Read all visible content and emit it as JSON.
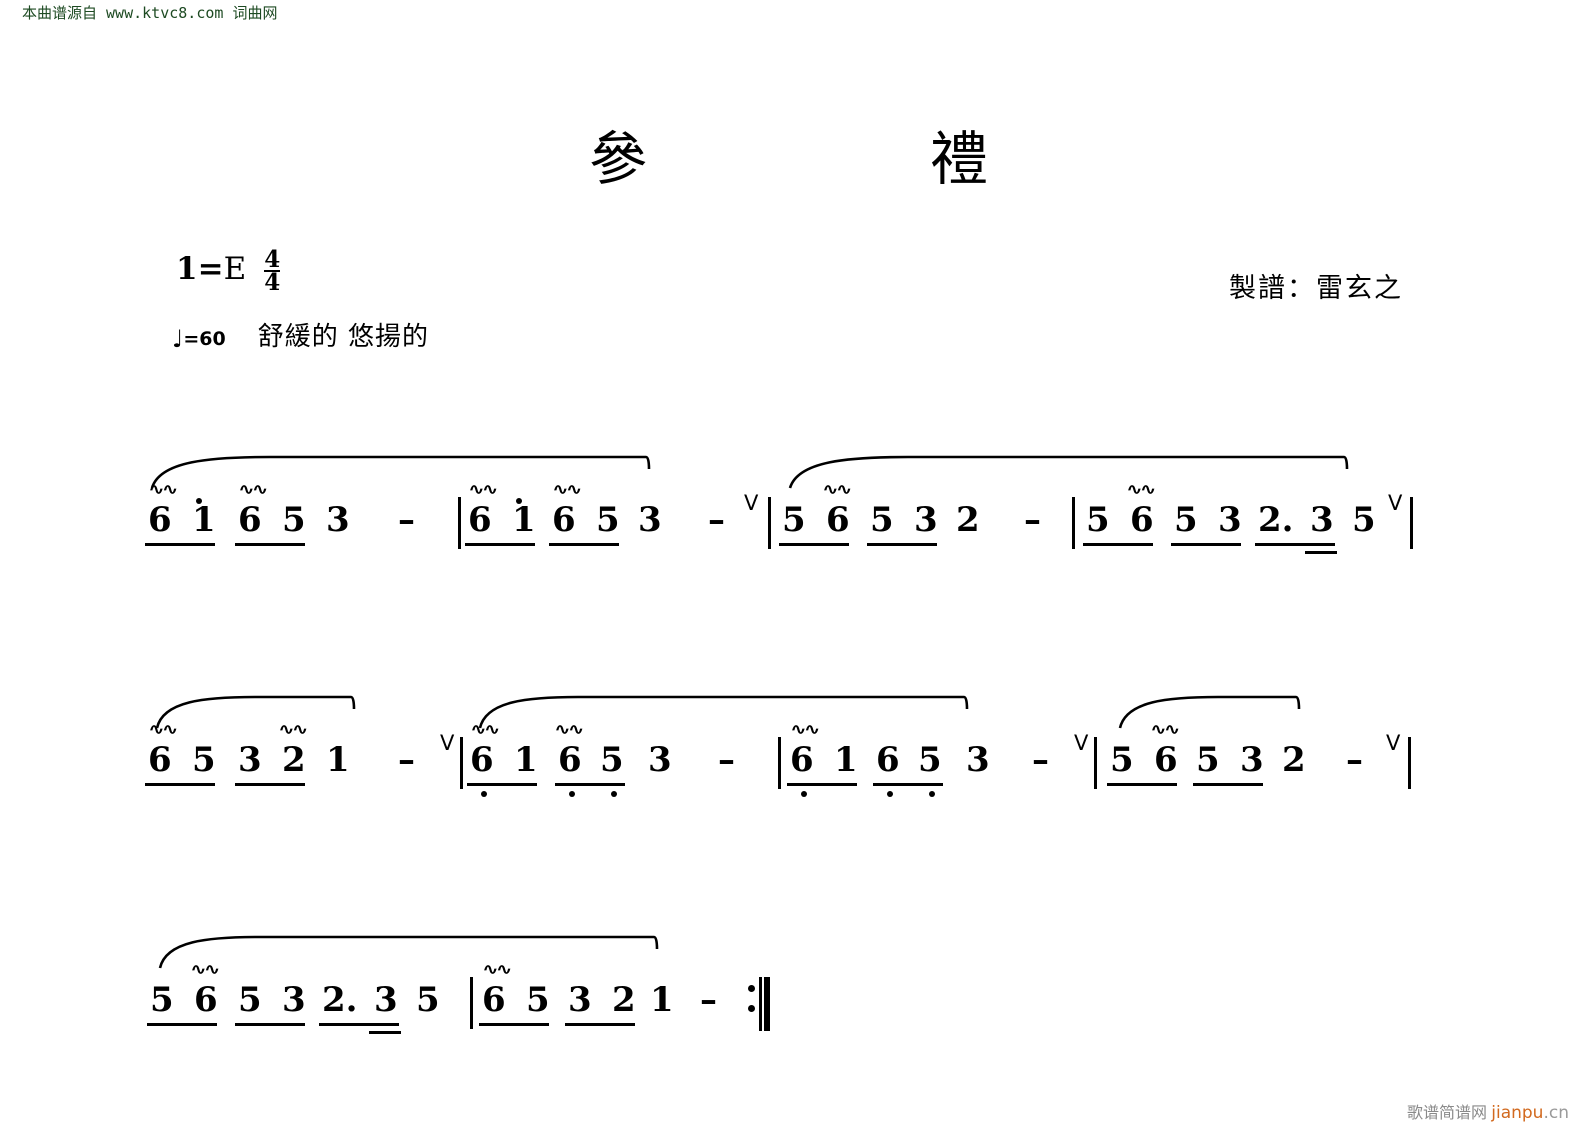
{
  "watermarks": {
    "top_left": "本曲谱源自 www.ktvc8.com 词曲网",
    "bottom_right_cn": "歌谱简谱网",
    "bottom_right_site": "jianpu",
    "bottom_right_tld": ".cn"
  },
  "header": {
    "title_left": "參",
    "title_right": "禮",
    "key_label": "1",
    "key_equals": "=",
    "key_value": "E",
    "time_numerator": "4",
    "time_denominator": "4",
    "tempo_note_glyph": "♩",
    "tempo_value": "=60",
    "expression": "舒緩的 悠揚的",
    "composer_credit": "製譜：雷玄之"
  },
  "colors": {
    "ink": "#000000",
    "watermark_top": "#1d4a22",
    "watermark_gray": "#8a8a8a",
    "watermark_orange": "#d2691e"
  },
  "score": {
    "notation_type": "jianpu-numbered-musical-notation",
    "symbols": {
      "trill": "~~",
      "breath_mark": "V",
      "sustain_dash": "–",
      "octave_up_dot": "dot-above",
      "octave_down_dot": "dot-below",
      "repeat_end": ":||"
    },
    "lines": [
      {
        "index": 1,
        "measures": [
          {
            "notes": [
              "6",
              "1",
              "6",
              "5",
              "3",
              "–"
            ],
            "beams": [
              [
                0,
                1
              ],
              [
                2,
                3
              ]
            ],
            "trills": [
              0,
              2
            ],
            "octave_up": [
              1
            ]
          },
          {
            "notes": [
              "6",
              "1",
              "6",
              "5",
              "3",
              "–"
            ],
            "beams": [
              [
                0,
                1
              ],
              [
                2,
                3
              ]
            ],
            "trills": [
              0,
              2
            ],
            "octave_up": [
              1
            ],
            "breath_after": true
          },
          {
            "notes": [
              "5",
              "6",
              "5",
              "3",
              "2",
              "–"
            ],
            "beams": [
              [
                0,
                1
              ],
              [
                2,
                3
              ]
            ],
            "trills": [
              1
            ]
          },
          {
            "notes": [
              "5",
              "6",
              "5",
              "3",
              "2.",
              "3",
              "5"
            ],
            "beams": [
              [
                0,
                1
              ],
              [
                2,
                3
              ],
              [
                4,
                5
              ]
            ],
            "trills": [
              1
            ],
            "dotted": [
              4
            ],
            "sixteenth": [
              5
            ],
            "breath_after": true
          }
        ]
      },
      {
        "index": 2,
        "measures": [
          {
            "notes": [
              "6",
              "5",
              "3",
              "2",
              "1",
              "–"
            ],
            "beams": [
              [
                0,
                1
              ],
              [
                2,
                3
              ]
            ],
            "trills": [
              0,
              3
            ],
            "breath_after": true
          },
          {
            "notes": [
              "6",
              "1",
              "6",
              "5",
              "3",
              "–"
            ],
            "beams": [
              [
                0,
                1
              ],
              [
                2,
                3
              ]
            ],
            "trills": [
              0,
              2
            ],
            "octave_down": [
              0,
              2,
              3
            ]
          },
          {
            "notes": [
              "6",
              "1",
              "6",
              "5",
              "3",
              "–"
            ],
            "beams": [
              [
                0,
                1
              ],
              [
                2,
                3
              ]
            ],
            "trills": [
              0
            ],
            "octave_down": [
              0,
              2,
              3
            ],
            "breath_after": true
          },
          {
            "notes": [
              "5",
              "6",
              "5",
              "3",
              "2",
              "–"
            ],
            "beams": [
              [
                0,
                1
              ],
              [
                2,
                3
              ]
            ],
            "trills": [
              1
            ],
            "breath_after": true
          }
        ]
      },
      {
        "index": 3,
        "measures": [
          {
            "notes": [
              "5",
              "6",
              "5",
              "3",
              "2.",
              "3",
              "5"
            ],
            "beams": [
              [
                0,
                1
              ],
              [
                2,
                3
              ],
              [
                4,
                5
              ]
            ],
            "trills": [
              1
            ],
            "dotted": [
              4
            ],
            "sixteenth": [
              5
            ]
          },
          {
            "notes": [
              "6",
              "5",
              "3",
              "2",
              "1",
              "–"
            ],
            "beams": [
              [
                0,
                1
              ],
              [
                2,
                3
              ]
            ],
            "trills": [
              0
            ],
            "ends_with_repeat": true
          }
        ]
      }
    ]
  }
}
